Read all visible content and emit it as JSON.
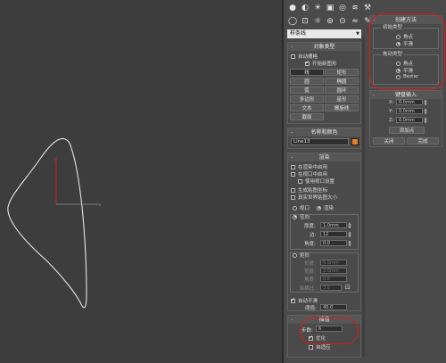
{
  "toolbar": {
    "row1": [
      "sphere-icon",
      "shapes-icon",
      "camera-icon",
      "light-icon",
      "helpers-icon",
      "spacewarps-icon",
      "systems-icon"
    ],
    "row2": [
      "create-tab-icon",
      "modify-tab-icon",
      "hierarchy-tab-icon",
      "motion-tab-icon",
      "display-tab-icon",
      "utilities-tab-icon"
    ]
  },
  "dropdown": {
    "value": "样条线"
  },
  "object_type": {
    "title": "对象类型",
    "auto_grid": "自动栅格",
    "start_new_shape": "开始新图形",
    "buttons": [
      [
        "线",
        "矩形"
      ],
      [
        "圆",
        "椭圆"
      ],
      [
        "弧",
        "圆环"
      ],
      [
        "多边形",
        "星形"
      ],
      [
        "文本",
        "螺旋线"
      ],
      [
        "截面",
        ""
      ]
    ]
  },
  "name_color": {
    "title": "名称和颜色",
    "name": "Line13",
    "color": "#e2822a"
  },
  "rendering": {
    "title": "渲染",
    "opt1": "在渲染中启用",
    "opt2": "在视口中启用",
    "opt3": "使用视口设置",
    "opt4": "生成贴图坐标",
    "opt5": "真实世界贴图大小",
    "viewport": "视口",
    "render": "渲染",
    "radial": "径向",
    "thickness_label": "厚度:",
    "thickness": "1.0mm",
    "sides_label": "边:",
    "sides": "12",
    "angle_label": "角度:",
    "angle": "0.0",
    "rect": "矩形",
    "length_label": "长度:",
    "length": "6.0mm",
    "width_label": "宽度:",
    "width": "2.0mm",
    "angle2_label": "角度:",
    "angle2": "0.0",
    "aspect_label": "纵横比:",
    "aspect": "3.0",
    "auto_smooth": "自动平滑",
    "threshold_label": "阈值:",
    "threshold": "40.0"
  },
  "interpolation": {
    "title": "插值",
    "steps_label": "步数:",
    "steps": "6",
    "optimize": "优化",
    "adaptive": "自适应"
  },
  "creation_method": {
    "title": "创建方法",
    "initial_type": "初始类型",
    "init_corner": "角点",
    "init_smooth": "平滑",
    "drag_type": "拖动类型",
    "drag_corner": "角点",
    "drag_smooth": "平滑",
    "drag_bezier": "Bezier"
  },
  "keyboard_entry": {
    "title": "键盘输入",
    "x_label": "X:",
    "x": "0.0mm",
    "y_label": "Y:",
    "y": "0.0mm",
    "z_label": "Z:",
    "z": "0.0mm",
    "add_point": "添加点",
    "close": "关闭",
    "finish": "完成"
  }
}
